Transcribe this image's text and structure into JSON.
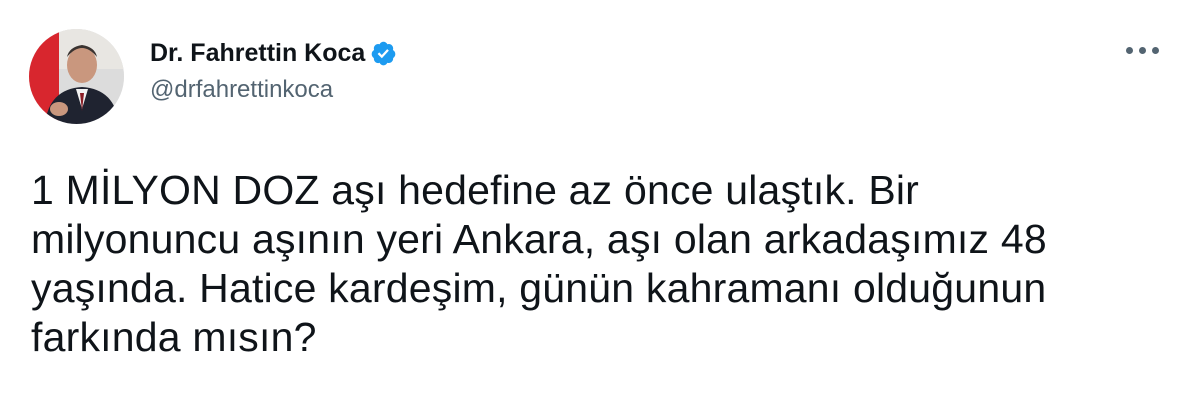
{
  "author": {
    "display_name": "Dr. Fahrettin Koca",
    "handle": "@drfahrettinkoca",
    "verified": true,
    "avatar_icon": "profile-photo"
  },
  "more_icon": "more-horizontal-icon",
  "tweet": {
    "lines": [
      "1 MİLYON DOZ aşı hedefine az önce ulaştık. Bir",
      "milyonuncu aşının yeri Ankara, aşı olan arkadaşımız 48",
      "yaşında. Hatice kardeşim, günün kahramanı olduğunun",
      "farkında mısın?"
    ]
  },
  "colors": {
    "verified_blue": "#1d9bf0",
    "text": "#0f1419",
    "secondary": "#536471"
  }
}
